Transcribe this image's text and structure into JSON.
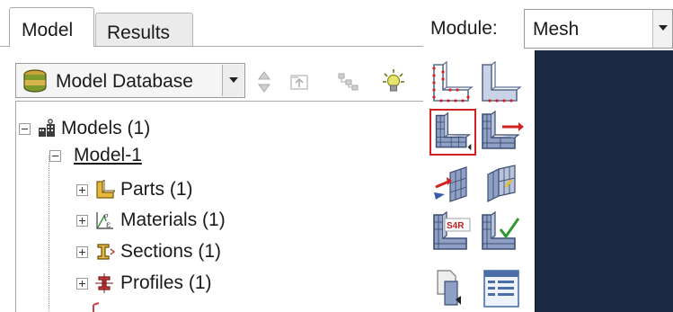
{
  "tabs": {
    "model": "Model",
    "results": "Results"
  },
  "toolbar": {
    "model_database_label": "Model Database",
    "icons": [
      "database-icon",
      "up-down-arrows-icon",
      "tree-filter-icon",
      "tree-expand-icon",
      "lightbulb-icon"
    ]
  },
  "tree": {
    "root": {
      "label": "Models (1)",
      "icon": "models-icon"
    },
    "model": {
      "label": "Model-1"
    },
    "items": [
      {
        "label": "Parts (1)",
        "icon": "parts-icon"
      },
      {
        "label": "Materials (1)",
        "icon": "materials-icon"
      },
      {
        "label": "Sections (1)",
        "icon": "sections-icon"
      },
      {
        "label": "Profiles (1)",
        "icon": "profiles-icon"
      }
    ]
  },
  "module": {
    "label": "Module:",
    "value": "Mesh"
  },
  "toolbox": {
    "tools": [
      "seed-part-icon",
      "seed-edges-icon",
      "mesh-part-icon",
      "mesh-region-icon",
      "assign-mesh-controls-icon",
      "assign-element-type-icon",
      "element-type-s4r-icon",
      "verify-mesh-icon",
      "mesh-partition-icon",
      "query-list-icon"
    ],
    "s4r_text": "S4R"
  },
  "colors": {
    "viewport": "#1c2a45",
    "selected_tool_border": "#d32121"
  }
}
